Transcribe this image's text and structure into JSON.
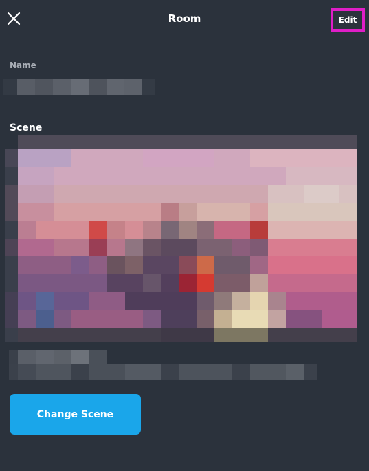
{
  "header": {
    "title": "Room",
    "edit_label": "Edit",
    "close_icon": "close-icon",
    "highlight_color": "#e01ec7"
  },
  "form": {
    "name_label": "Name",
    "scene_label": "Scene"
  },
  "actions": {
    "change_scene_label": "Change Scene",
    "button_color": "#1aa6ea"
  },
  "colors": {
    "background": "#2b323c",
    "label_muted": "#a8adb5"
  }
}
